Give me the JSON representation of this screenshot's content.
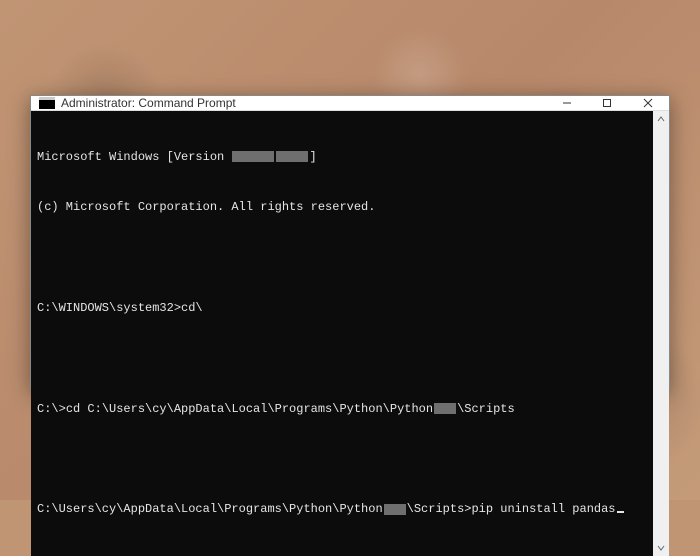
{
  "window": {
    "title": "Administrator: Command Prompt"
  },
  "terminal": {
    "banner_prefix": "Microsoft Windows [Version ",
    "banner_suffix": "]",
    "copyright": "(c) Microsoft Corporation. All rights reserved.",
    "line1_prompt": "C:\\WINDOWS\\system32>",
    "line1_cmd": "cd\\",
    "line2_prompt": "C:\\>",
    "line2_cmd_a": "cd C:\\Users\\cy\\AppData\\Local\\Programs\\Python\\Python",
    "line2_cmd_b": "\\Scripts",
    "line3_prompt_a": "C:\\Users\\cy\\AppData\\Local\\Programs\\Python\\Python",
    "line3_prompt_b": "\\Scripts>",
    "line3_cmd": "pip uninstall pandas"
  }
}
